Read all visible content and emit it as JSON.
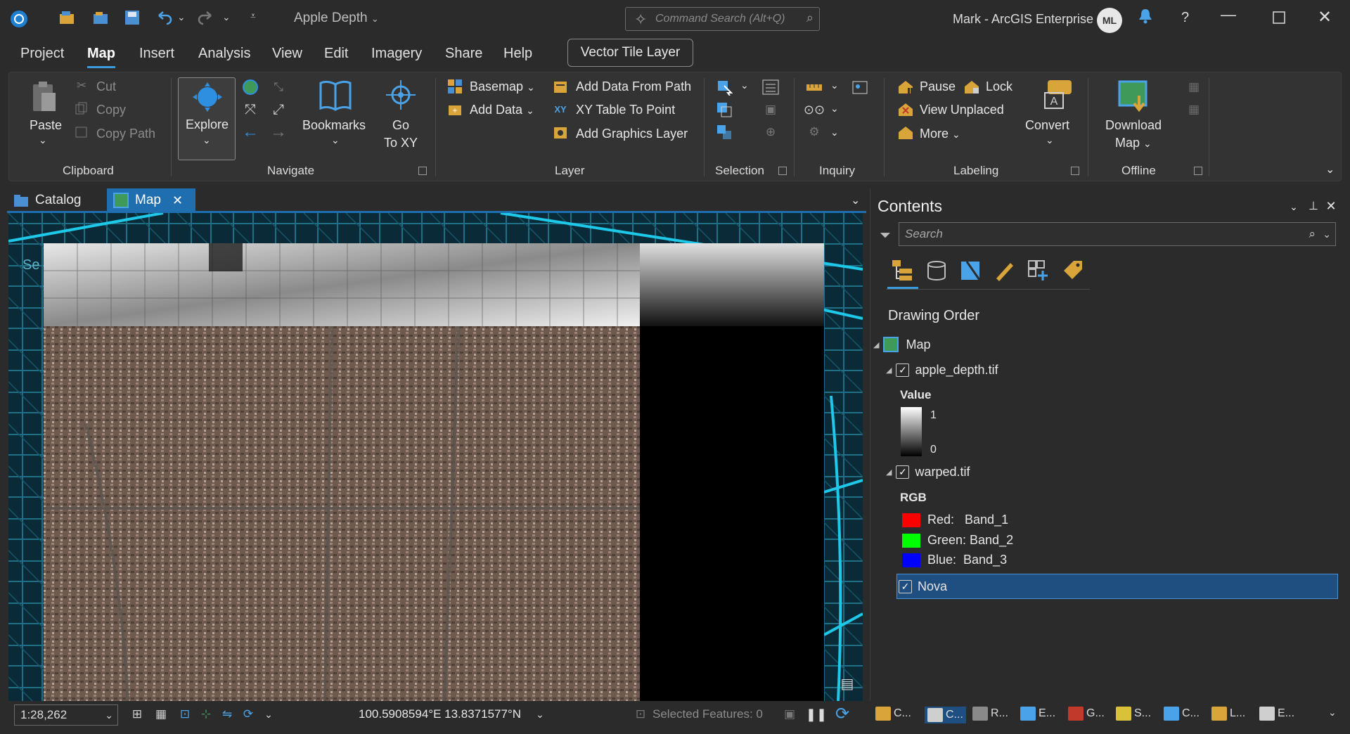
{
  "titlebar": {
    "project_title": "Apple Depth",
    "command_search_placeholder": "Command Search (Alt+Q)",
    "user_label": "Mark - ArcGIS Enterprise",
    "avatar_initials": "ML"
  },
  "ribbon_tabs": [
    "Project",
    "Map",
    "Insert",
    "Analysis",
    "View",
    "Edit",
    "Imagery",
    "Share",
    "Help"
  ],
  "active_ribbon_tab": "Map",
  "context_tab": "Vector Tile Layer",
  "ribbon": {
    "clipboard": {
      "paste": "Paste",
      "cut": "Cut",
      "copy": "Copy",
      "copy_path": "Copy Path",
      "group": "Clipboard"
    },
    "navigate": {
      "explore": "Explore",
      "bookmarks": "Bookmarks",
      "go_to_xy_1": "Go",
      "go_to_xy_2": "To XY",
      "group": "Navigate"
    },
    "layer": {
      "basemap": "Basemap",
      "add_data": "Add Data",
      "add_data_from_path": "Add Data From Path",
      "xy_table_to_point": "XY Table To Point",
      "add_graphics_layer": "Add Graphics Layer",
      "group": "Layer"
    },
    "selection": {
      "group": "Selection"
    },
    "inquiry": {
      "group": "Inquiry"
    },
    "labeling": {
      "pause": "Pause",
      "lock": "Lock",
      "view_unplaced": "View Unplaced",
      "more": "More",
      "convert": "Convert",
      "group": "Labeling"
    },
    "offline": {
      "download_map_1": "Download",
      "download_map_2": "Map",
      "group": "Offline"
    }
  },
  "doc_tabs": {
    "catalog": "Catalog",
    "map": "Map"
  },
  "map": {
    "corner_label": "Se"
  },
  "status": {
    "scale": "1:28,262",
    "coordinates": "100.5908594°E 13.8371577°N",
    "selected_features": "Selected Features: 0"
  },
  "contents": {
    "title": "Contents",
    "search_placeholder": "Search",
    "drawing_order": "Drawing Order",
    "map_label": "Map",
    "layers": {
      "apple_depth": "apple_depth.tif",
      "value_label": "Value",
      "value_high": "1",
      "value_low": "0",
      "warped": "warped.tif",
      "rgb_label": "RGB",
      "red": "Red:   Band_1",
      "green": "Green: Band_2",
      "blue": "Blue:  Band_3",
      "nova": "Nova"
    },
    "colors": {
      "red": "#ff0000",
      "green": "#00ff00",
      "blue": "#0000ff",
      "accent": "#1f6fb0"
    }
  },
  "bottom_tabs": [
    "C...",
    "C...",
    "R...",
    "E...",
    "G...",
    "S...",
    "C...",
    "L...",
    "E..."
  ]
}
